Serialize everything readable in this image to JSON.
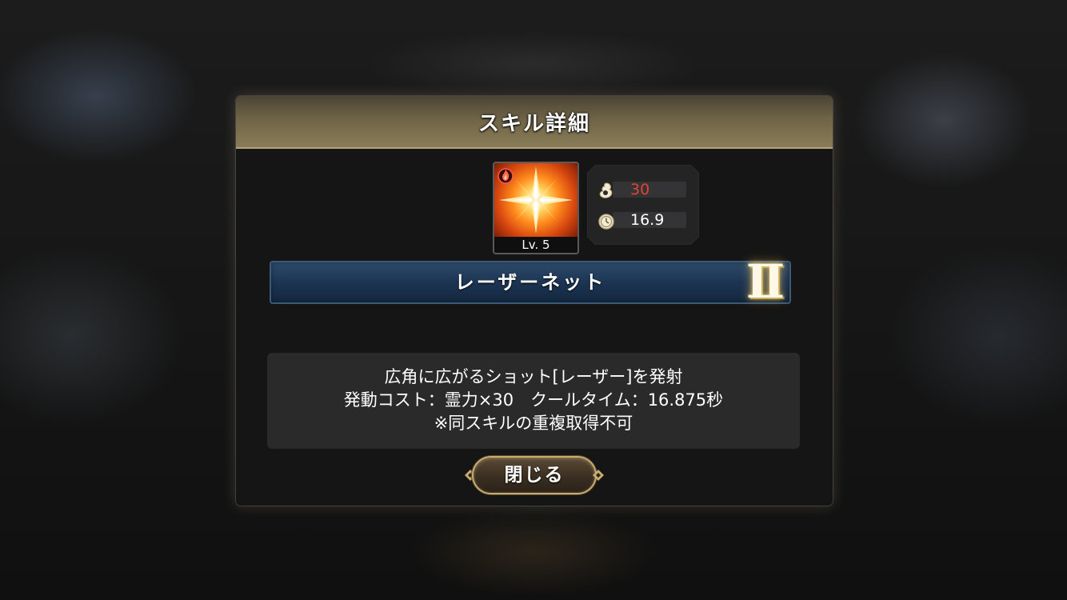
{
  "dialog": {
    "title": "スキル詳細"
  },
  "skill": {
    "level_label": "Lv. 5",
    "icon": "laser-net-skill-icon",
    "element_icon": "fire-element-icon",
    "name": "レーザーネット",
    "rank": "II",
    "cost": "30",
    "cost_icon": "spirit-power-icon",
    "cooldown": "16.9",
    "cooldown_icon": "stopwatch-icon"
  },
  "description": {
    "line1": "広角に広がるショット[レーザー]を発射",
    "line2": "発動コスト：霊力×30　クールタイム：16.875秒",
    "line3": "※同スキルの重複取得不可"
  },
  "buttons": {
    "close_label": "閉じる"
  },
  "colors": {
    "cost_value": "#e0452f",
    "name_bar": "#1c3553",
    "title_bar": "#6f6447",
    "button_border": "#c9ad70"
  }
}
